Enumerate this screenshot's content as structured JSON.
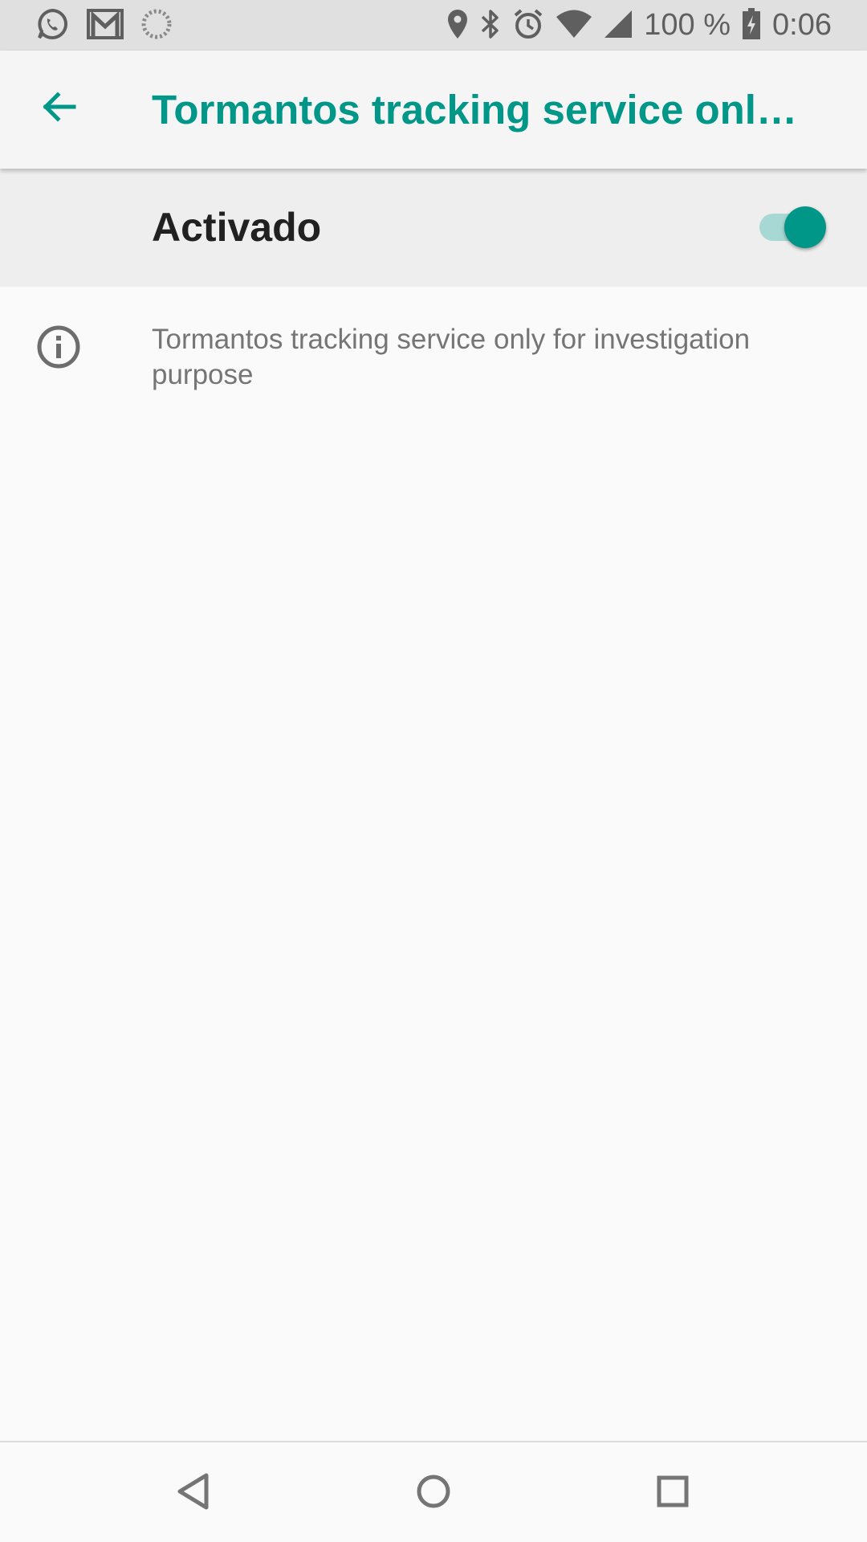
{
  "status_bar": {
    "left_icons": [
      "whatsapp-icon",
      "gmail-icon",
      "sync-icon"
    ],
    "right_icons": [
      "location-icon",
      "bluetooth-icon",
      "alarm-icon",
      "wifi-icon",
      "cellular-signal-icon"
    ],
    "battery_text": "100 %",
    "battery_icon": "battery-charging-icon",
    "time": "0:06"
  },
  "app_bar": {
    "back_icon": "arrow-back-icon",
    "title": "Tormantos tracking service only for investigation purpose"
  },
  "main_switch": {
    "label": "Activado",
    "checked": true
  },
  "info": {
    "icon": "info-icon",
    "text": "Tormantos tracking service only for investigation purpose"
  },
  "nav_bar": {
    "buttons": [
      "back-triangle-icon",
      "home-circle-icon",
      "recents-square-icon"
    ]
  },
  "colors": {
    "accent": "#009688",
    "accent_track": "#a8d8d3",
    "status_bar_bg": "#e0e0e0",
    "app_bar_bg": "#f5f5f5",
    "switch_row_bg": "#eeeeee",
    "page_bg": "#fafafa"
  }
}
